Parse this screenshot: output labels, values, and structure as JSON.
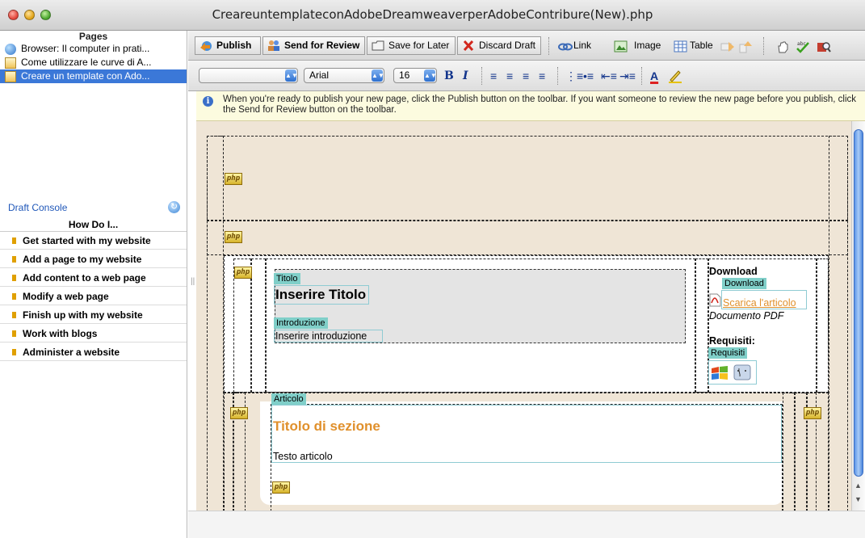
{
  "window": {
    "title": "CreareuntemplateconAdobeDreamweaverperAdobeContribure(New).php"
  },
  "sidebar": {
    "pages_heading": "Pages",
    "pages": [
      {
        "label": "Browser: Il computer in prati...",
        "icon": "globe-icon",
        "selected": false
      },
      {
        "label": "Come utilizzare le curve di A...",
        "icon": "draft-page-icon",
        "selected": false
      },
      {
        "label": "Creare un template con Ado...",
        "icon": "draft-page-icon",
        "selected": true
      }
    ],
    "draft_console": "Draft Console",
    "how_do_i": "How Do I...",
    "help_items": [
      "Get started with my website",
      "Add a page to my website",
      "Add content to a web page",
      "Modify a web page",
      "Finish up with my website",
      "Work with blogs",
      "Administer a website"
    ]
  },
  "toolbar": {
    "publish": "Publish",
    "send_for_review": "Send for Review",
    "save_for_later": "Save for Later",
    "discard_draft": "Discard Draft",
    "link": "Link",
    "image": "Image",
    "table": "Table"
  },
  "format_bar": {
    "style_value": "",
    "font_value": "Arial",
    "size_value": "16",
    "bold": "B",
    "italic": "I",
    "text_color": "A"
  },
  "info": {
    "message": "When you're ready to publish your new page, click the Publish button on the toolbar. If you want someone to review the new page before you publish, click the Send for Review button on the toolbar."
  },
  "editor": {
    "php_tag": "php",
    "titolo_label": "Titolo",
    "titolo_value": "Inserire Titolo",
    "intro_label": "Introduzione",
    "intro_value": "Inserire introduzione",
    "download_heading": "Download",
    "download_label": "Download",
    "download_link": "Scarica l'articolo",
    "pdf_caption": "Documento PDF",
    "requisiti_heading": "Requisiti:",
    "requisiti_label": "Requisiti",
    "articolo_label": "Articolo",
    "section_title": "Titolo di sezione",
    "article_text": "Testo articolo"
  },
  "colors": {
    "selection": "#3b78d8",
    "link": "#1f57b9",
    "tag_teal": "#80cfc9",
    "section_orange": "#e0902c",
    "editor_bg": "#efe5d6"
  }
}
